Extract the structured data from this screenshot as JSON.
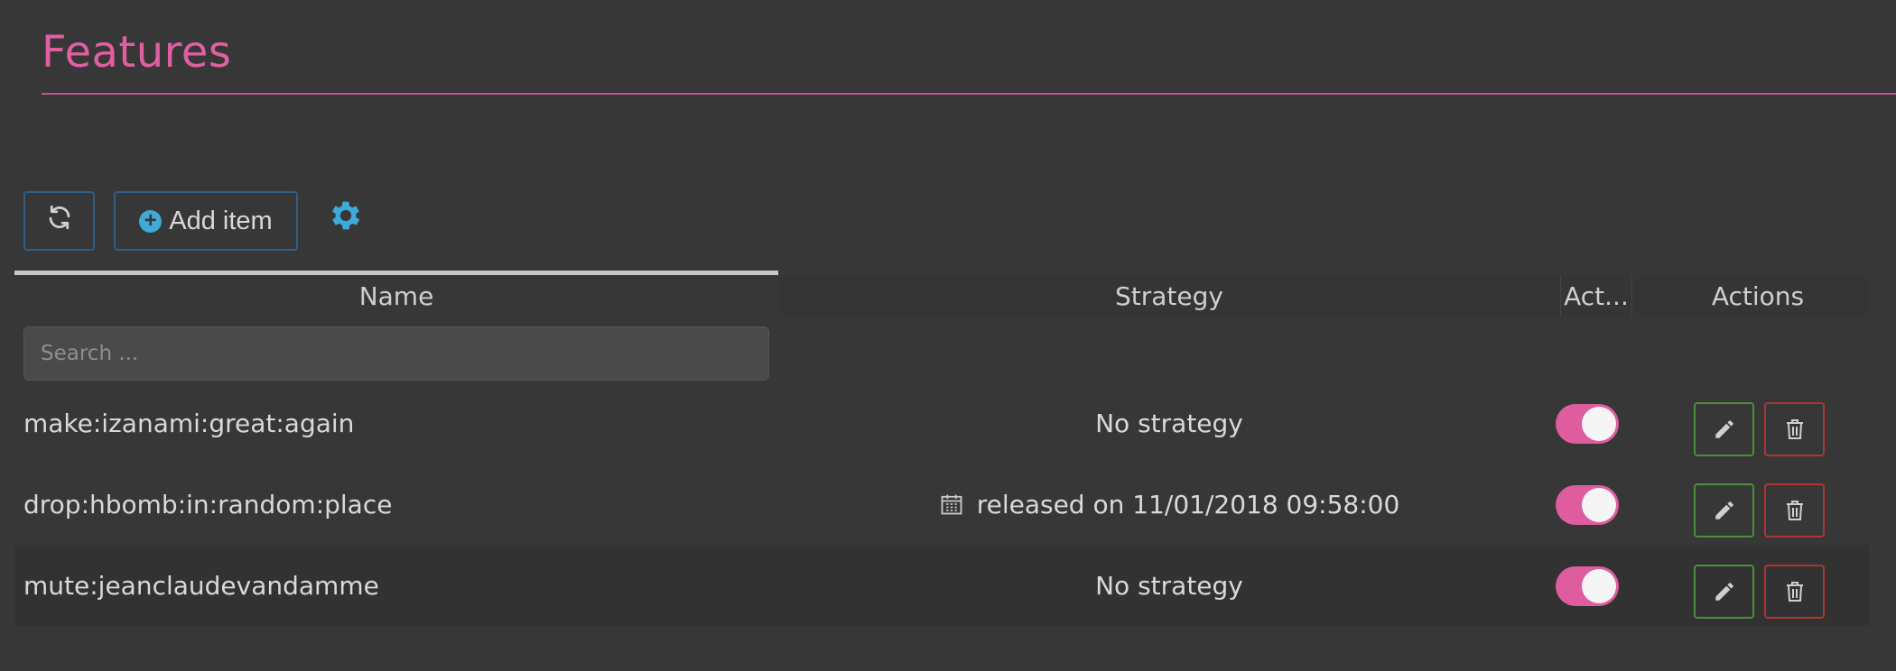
{
  "page": {
    "title": "Features"
  },
  "toolbar": {
    "refresh_icon": "refresh-icon",
    "add_label": "Add item",
    "settings_icon": "gear-icon"
  },
  "table": {
    "columns": [
      "Name",
      "Strategy",
      "Act...",
      "Actions"
    ],
    "search_placeholder": "Search ...",
    "rows": [
      {
        "name": "make:izanami:great:again",
        "strategy": "No strategy",
        "strategy_icon": "",
        "active": true
      },
      {
        "name": "drop:hbomb:in:random:place",
        "strategy": "released on 11/01/2018 09:58:00",
        "strategy_icon": "calendar-icon",
        "active": true
      },
      {
        "name": "mute:jeanclaudevandamme",
        "strategy": "No strategy",
        "strategy_icon": "",
        "active": true
      }
    ]
  },
  "colors": {
    "accent": "#e05fa2",
    "info": "#3fa9d8",
    "success_border": "#4c8e3c",
    "danger_border": "#b03434",
    "background": "#373737"
  }
}
